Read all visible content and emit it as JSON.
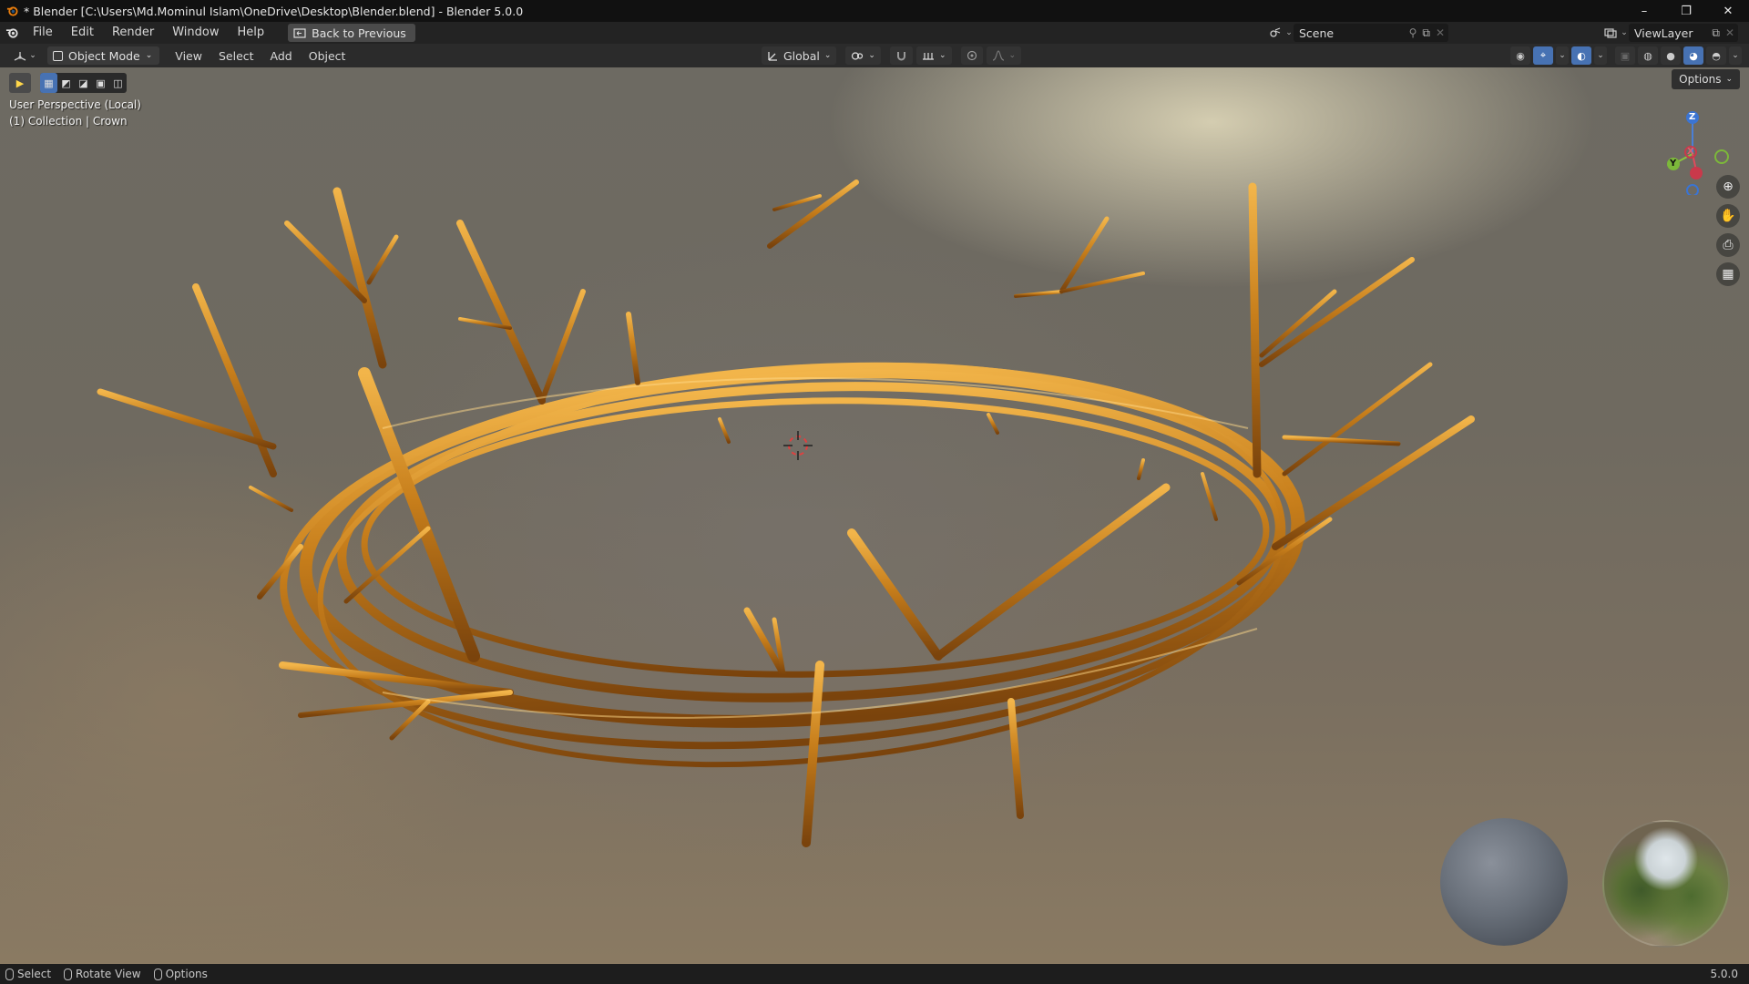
{
  "window": {
    "title": "* Blender [C:\\Users\\Md.Mominul Islam\\OneDrive\\Desktop\\Blender.blend] - Blender 5.0.0",
    "controls": [
      "–",
      "❐",
      "✕"
    ]
  },
  "menubar": {
    "items": [
      "File",
      "Edit",
      "Render",
      "Window",
      "Help"
    ],
    "back_button": "Back to Previous",
    "scene": "Scene",
    "view_layer": "ViewLayer"
  },
  "viewport_header": {
    "mode": "Object Mode",
    "menus": [
      "View",
      "Select",
      "Add",
      "Object"
    ],
    "transform_orientation": "Global"
  },
  "viewport": {
    "options_label": "Options",
    "perspective_label": "User Perspective (Local)",
    "collection_label": "(1) Collection | Crown",
    "gizmo_axes": [
      "Z",
      "X",
      "Y"
    ],
    "nav_icons": [
      "zoom-icon",
      "pan-hand-icon",
      "camera-icon",
      "grid-icon"
    ],
    "crown_color": "#c8821e"
  },
  "statusbar": {
    "items": [
      "Select",
      "Rotate View",
      "Options"
    ],
    "version": "5.0.0"
  }
}
